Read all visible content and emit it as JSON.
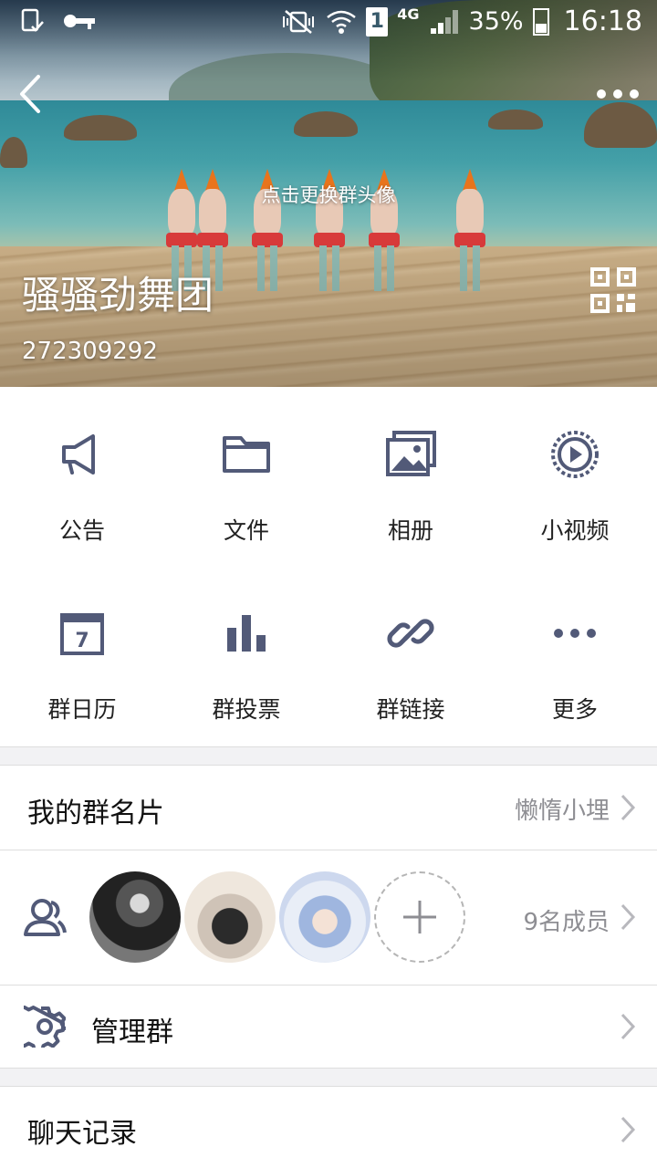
{
  "status_bar": {
    "battery": "35%",
    "time": "16:18",
    "network": "4G",
    "sim": "1"
  },
  "header": {
    "change_avatar_hint": "点击更换群头像",
    "group_name": "骚骚劲舞团",
    "group_id": "272309292",
    "icons": [
      "back-icon",
      "more-icon",
      "qr-code-icon"
    ]
  },
  "features": [
    {
      "label": "公告",
      "icon": "announcement-icon"
    },
    {
      "label": "文件",
      "icon": "folder-icon"
    },
    {
      "label": "相册",
      "icon": "album-icon"
    },
    {
      "label": "小视频",
      "icon": "video-icon"
    },
    {
      "label": "群日历",
      "icon": "calendar-icon",
      "day": "7"
    },
    {
      "label": "群投票",
      "icon": "poll-icon"
    },
    {
      "label": "群链接",
      "icon": "link-icon"
    },
    {
      "label": "更多",
      "icon": "more-dots-icon"
    }
  ],
  "my_card": {
    "title": "我的群名片",
    "value": "懒惰小埋"
  },
  "members": {
    "count_label": "9名成员"
  },
  "manage": {
    "title": "管理群"
  },
  "chat_history": {
    "title": "聊天记录"
  },
  "colors": {
    "icon": "#525a78",
    "divider": "#dedede",
    "secondary_text": "#8e8e93",
    "page_bg": "#f2f2f4"
  }
}
